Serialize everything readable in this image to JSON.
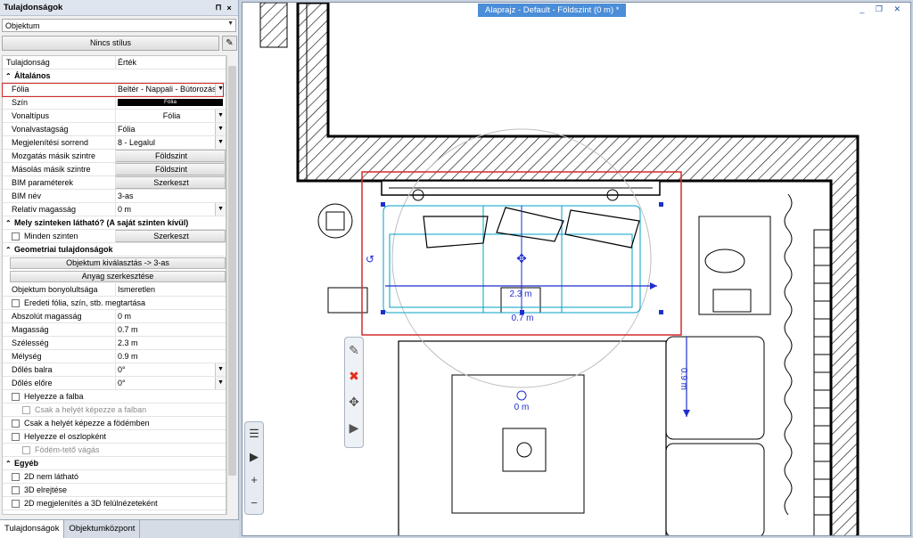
{
  "panel": {
    "title": "Tulajdonságok",
    "pin": "⊓",
    "close": "×",
    "object_combo": "Objektum",
    "style_button": "Nincs stílus"
  },
  "grid": {
    "header": {
      "prop": "Tulajdonság",
      "value": "Érték"
    },
    "sec_general": "Általános",
    "rows": [
      {
        "label": "Fólia",
        "value": "Beltér - Nappali - Bútorozás"
      },
      {
        "label": "Szín",
        "value": "Fólia"
      },
      {
        "label": "Vonaltípus",
        "value": "Fólia"
      },
      {
        "label": "Vonalvastagság",
        "value": "Fólia"
      },
      {
        "label": "Megjelenítési sorrend",
        "value": "8 - Legalul"
      },
      {
        "label": "Mozgatás másik szintre",
        "value": "Földszint"
      },
      {
        "label": "Másolás másik szintre",
        "value": "Földszint"
      },
      {
        "label": "BIM paraméterek",
        "value": "Szerkeszt"
      },
      {
        "label": "BIM név",
        "value": "3-as"
      },
      {
        "label": "Relatív magasság",
        "value": "0 m"
      }
    ],
    "sec_levels": "Mely szinteken látható? (A saját szinten kívül)",
    "all_levels": {
      "label": "Minden szinten",
      "value": "Szerkeszt"
    },
    "sec_geo": "Geometriai tulajdonságok",
    "btn_select": "Objektum kiválasztás -> 3-as",
    "btn_material": "Anyag szerkesztése",
    "geo_rows": [
      {
        "label": "Objektum bonyolultsága",
        "value": "Ismeretlen"
      }
    ],
    "cb_original": "Eredeti fólia, szín, stb. megtartása",
    "dims": [
      {
        "label": "Abszolút magasság",
        "value": "0 m"
      },
      {
        "label": "Magasság",
        "value": "0.7 m"
      },
      {
        "label": "Szélesség",
        "value": "2.3 m"
      },
      {
        "label": "Mélység",
        "value": "0.9 m"
      },
      {
        "label": "Dőlés balra",
        "value": "0°"
      },
      {
        "label": "Dőlés előre",
        "value": "0°"
      }
    ],
    "checks": [
      {
        "label": "Helyezze a falba",
        "indent": false
      },
      {
        "label": "Csak a helyét képezze a falban",
        "indent": true
      },
      {
        "label": "Csak a helyét képezze a födémben",
        "indent": false
      },
      {
        "label": "Helyezze el oszlopként",
        "indent": false
      },
      {
        "label": "Födém-tető vágás",
        "indent": true
      }
    ],
    "sec_other": "Egyéb",
    "other_checks": [
      "2D nem látható",
      "3D elrejtése",
      "2D megjelenítés a 3D felülnézeteként"
    ]
  },
  "tabs": [
    "Tulajdonságok",
    "Objektumközpont"
  ],
  "view": {
    "title": "Alaprajz - Default - Földszint (0 m) *",
    "win_controls": "_ ❐ ✕"
  },
  "dims_labels": {
    "width": "2.3 m",
    "depth_small": "0.7 m",
    "depth": "0.9 m",
    "height": "0 m"
  },
  "colors": {
    "accent": "#4a8dd8",
    "select": "#00a0c6",
    "dim": "#1f2ecf",
    "highlight": "#d42a2a"
  }
}
